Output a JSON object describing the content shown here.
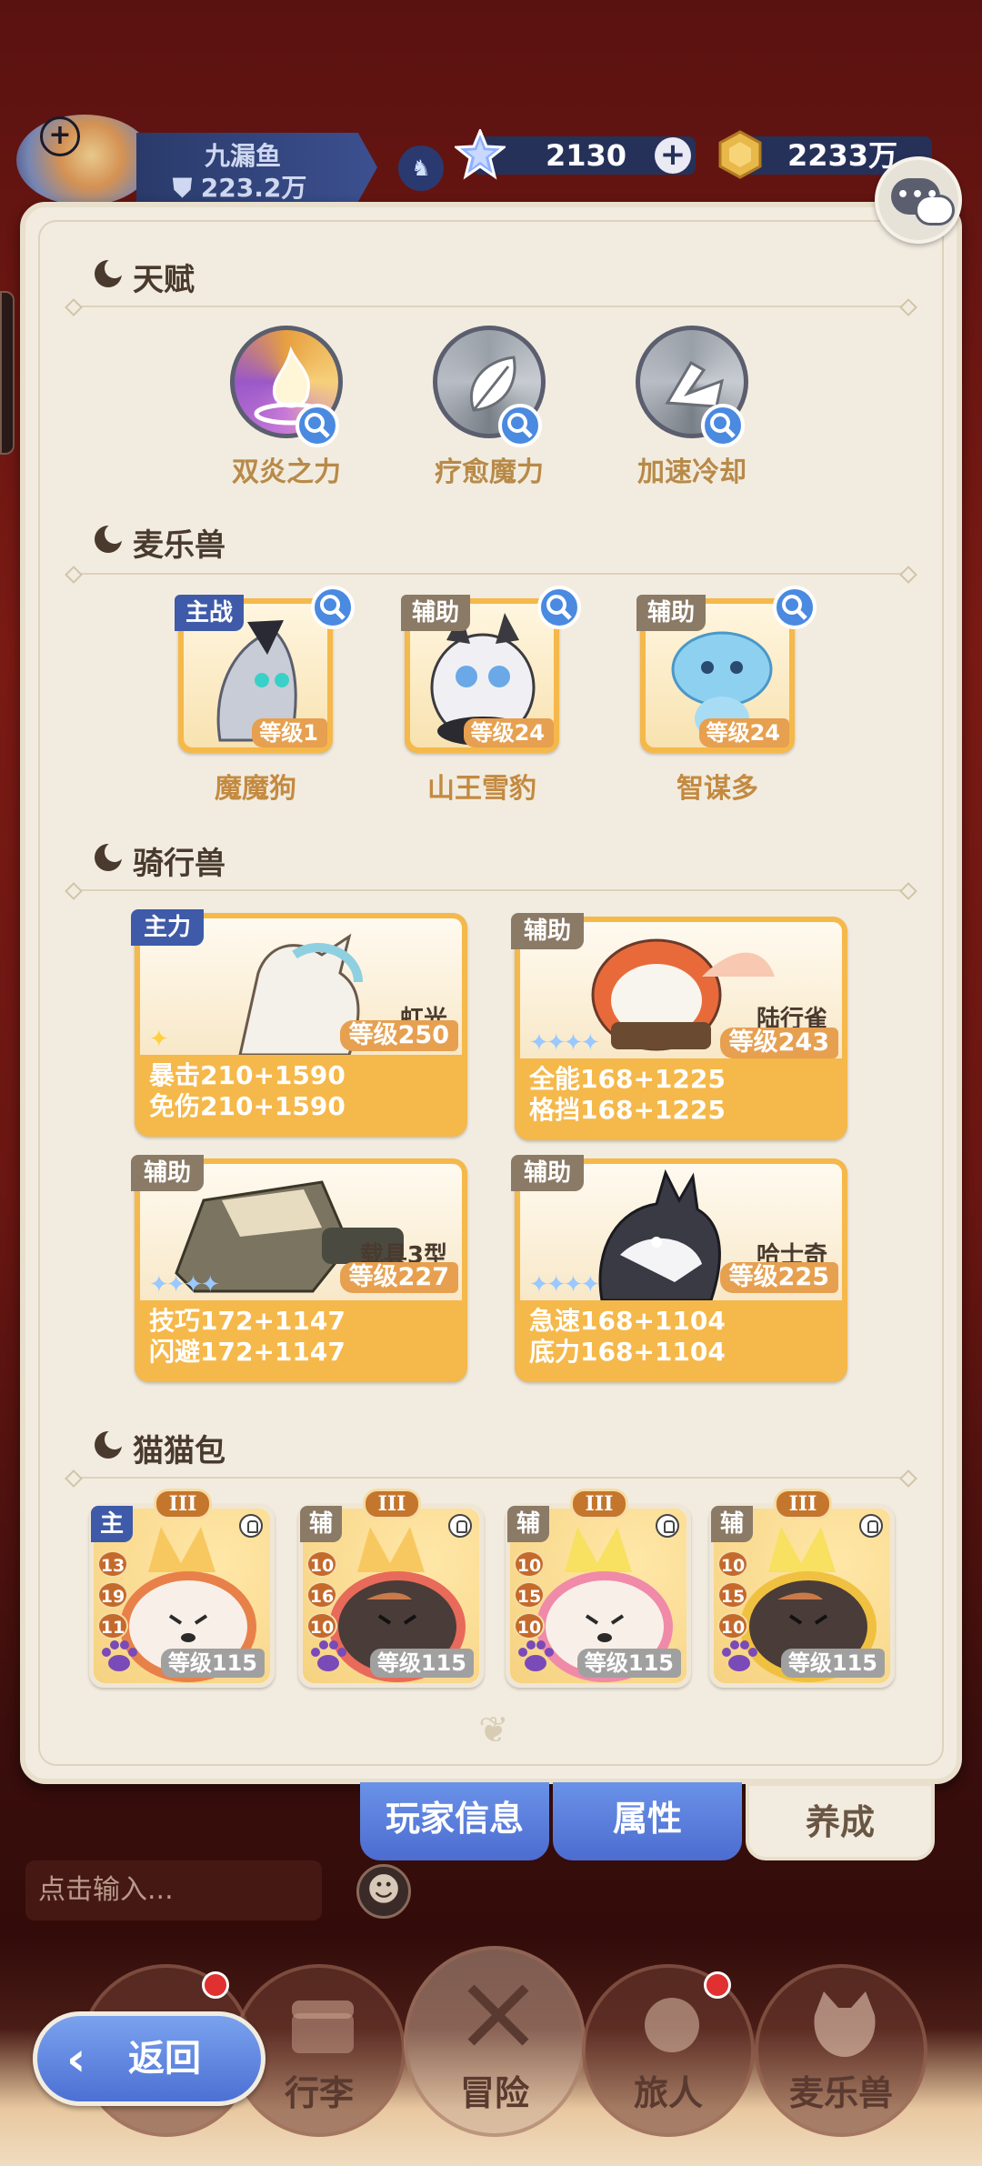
{
  "player": {
    "name": "九漏鱼",
    "power": "223.2万"
  },
  "resources": {
    "gems": "2130",
    "gold": "2233万"
  },
  "sections": {
    "talent": "天赋",
    "pets": "麦乐兽",
    "mounts": "骑行兽",
    "cats": "猫猫包"
  },
  "talents": [
    {
      "name": "双炎之力"
    },
    {
      "name": "疗愈魔力"
    },
    {
      "name": "加速冷却"
    }
  ],
  "pets": [
    {
      "role": "主战",
      "level": "等级1",
      "name": "魔魔狗"
    },
    {
      "role": "辅助",
      "level": "等级24",
      "name": "山王雪豹"
    },
    {
      "role": "辅助",
      "level": "等级24",
      "name": "智谋多"
    }
  ],
  "mounts": [
    {
      "role": "主力",
      "name": "虹光",
      "level": "等级250",
      "stat1": "暴击210+1590",
      "stat2": "免伤210+1590"
    },
    {
      "role": "辅助",
      "name": "陆行雀",
      "level": "等级243",
      "stat1": "全能168+1225",
      "stat2": "格挡168+1225"
    },
    {
      "role": "辅助",
      "name": "载具3型",
      "level": "等级227",
      "stat1": "技巧172+1147",
      "stat2": "闪避172+1147"
    },
    {
      "role": "辅助",
      "name": "哈士奇",
      "level": "等级225",
      "stat1": "急速168+1104",
      "stat2": "底力168+1104"
    }
  ],
  "cats": [
    {
      "role": "主",
      "tier": "III",
      "n1": "13",
      "n2": "19",
      "n3": "11",
      "level": "等级115"
    },
    {
      "role": "辅",
      "tier": "III",
      "n1": "10",
      "n2": "16",
      "n3": "10",
      "level": "等级115"
    },
    {
      "role": "辅",
      "tier": "III",
      "n1": "10",
      "n2": "15",
      "n3": "10",
      "level": "等级115"
    },
    {
      "role": "辅",
      "tier": "III",
      "n1": "10",
      "n2": "15",
      "n3": "10",
      "level": "等级115"
    }
  ],
  "tabs": {
    "info": "玩家信息",
    "attr": "属性",
    "train": "养成"
  },
  "chat": {
    "placeholder": "点击输入..."
  },
  "nav": {
    "bag": "行李",
    "adventure": "冒险",
    "traveler": "旅人",
    "pets": "麦乐兽",
    "back": "返回"
  }
}
